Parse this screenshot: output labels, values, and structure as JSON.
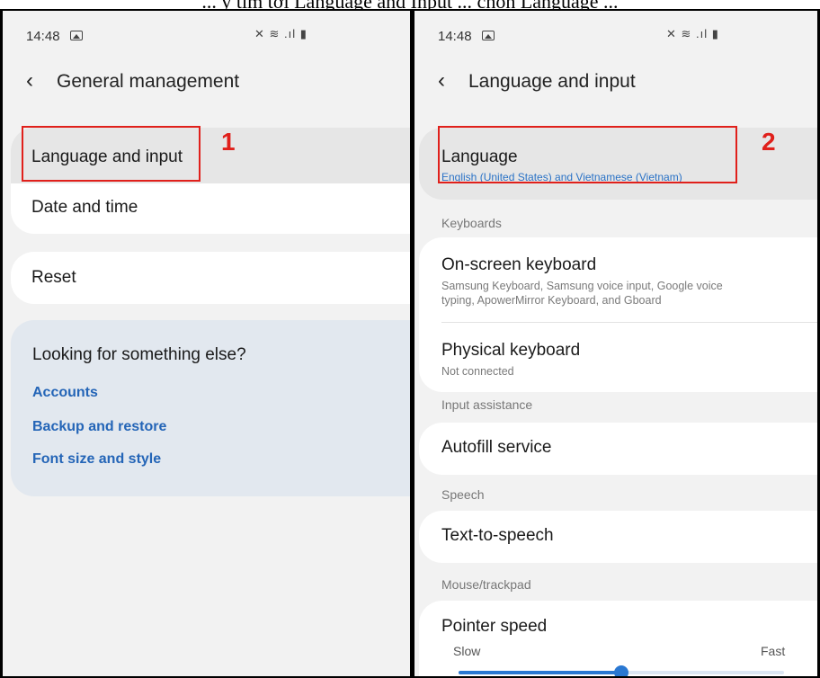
{
  "caption": "... y tìm tới Language and Input ... chọn Language ...",
  "left_screen": {
    "status": {
      "time": "14:48",
      "icons": [
        "image-icon",
        "mute-icon",
        "wifi-icon",
        "signal-icon",
        "battery-icon"
      ],
      "sys_glyphs": "✕ ≋ .ıl ▮"
    },
    "title": "General management",
    "items": [
      {
        "label": "Language and input",
        "highlighted": true
      },
      {
        "label": "Date and time"
      },
      {
        "label": "Reset"
      }
    ],
    "looking_for": {
      "title": "Looking for something else?",
      "links": [
        "Accounts",
        "Backup and restore",
        "Font size and style"
      ]
    },
    "annotation": "1"
  },
  "right_screen": {
    "status": {
      "time": "14:48",
      "sys_glyphs": "✕ ≋ .ıl ▮"
    },
    "title": "Language and input",
    "language": {
      "label": "Language",
      "value": "English (United States) and Vietnamese (Vietnam)"
    },
    "annotation": "2",
    "sections": {
      "keyboards": "Keyboards",
      "input_assistance": "Input assistance",
      "speech": "Speech",
      "mouse": "Mouse/trackpad"
    },
    "on_screen_keyboard": {
      "label": "On-screen keyboard",
      "sub_line1": "Samsung Keyboard, Samsung voice input, Google voice",
      "sub_line2": "typing, ApowerMirror Keyboard, and Gboard"
    },
    "physical_keyboard": {
      "label": "Physical keyboard",
      "sub": "Not connected"
    },
    "autofill": "Autofill service",
    "tts": "Text-to-speech",
    "pointer_speed": {
      "label": "Pointer speed",
      "min_label": "Slow",
      "max_label": "Fast",
      "value_fraction": 0.5
    }
  },
  "colors": {
    "accent": "#2a78d2",
    "link": "#2465b7",
    "annotation": "#e0201b"
  }
}
